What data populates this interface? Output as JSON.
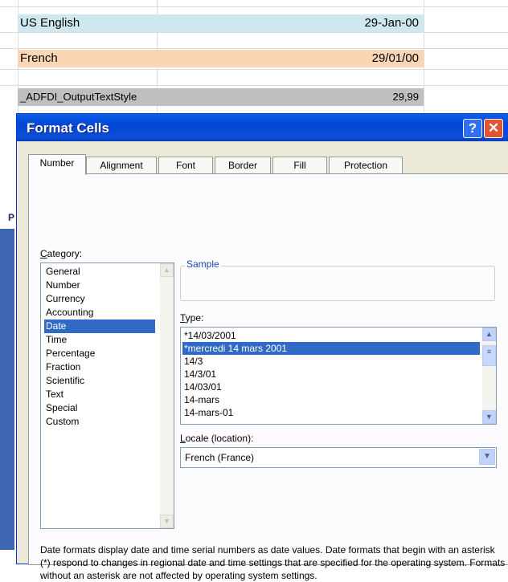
{
  "sheet": {
    "rows": [
      {
        "label": "US English",
        "value": "29-Jan-00",
        "color": "#cfe8f0"
      },
      {
        "label": "French",
        "value": "29/01/00",
        "color": "#fcd5b5"
      },
      {
        "label": "_ADFDI_OutputTextStyle",
        "value": "29,99",
        "color": "#bfbfbf"
      }
    ],
    "peek_letter": "P"
  },
  "dialog": {
    "title": "Format Cells",
    "help_label": "?",
    "close_label": "✕",
    "tabs": [
      "Number",
      "Alignment",
      "Font",
      "Border",
      "Fill",
      "Protection"
    ],
    "active_tab": "Number",
    "category_label_prefix": "C",
    "category_label_rest": "ategory:",
    "categories": [
      "General",
      "Number",
      "Currency",
      "Accounting",
      "Date",
      "Time",
      "Percentage",
      "Fraction",
      "Scientific",
      "Text",
      "Special",
      "Custom"
    ],
    "selected_category": "Date",
    "sample_label": "Sample",
    "type_label_prefix": "T",
    "type_label_rest": "ype:",
    "types": [
      "*14/03/2001",
      "*mercredi 14 mars 2001",
      "14/3",
      "14/3/01",
      "14/03/01",
      "14-mars",
      "14-mars-01"
    ],
    "selected_type": "*mercredi 14 mars 2001",
    "locale_label_prefix": "L",
    "locale_label_rest": "ocale (location):",
    "locale_value": "French (France)",
    "description": "Date formats display date and time serial numbers as date values.  Date formats that begin with an asterisk (*) respond to changes in regional date and time settings that are specified for the operating system. Formats without an asterisk are not affected by operating system settings."
  }
}
